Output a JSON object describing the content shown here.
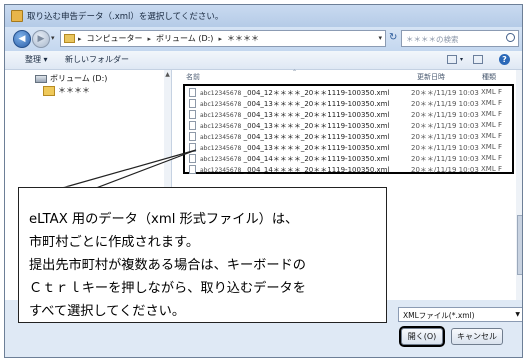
{
  "window": {
    "title": "取り込む申告データ（.xml）を選択してください。"
  },
  "address_bar": {
    "back_glyph": "◀",
    "forward_glyph": "▶",
    "dropdown_glyph": "▾",
    "crumbs": [
      "コンピューター",
      "ボリューム (D:)",
      "＊＊＊＊"
    ],
    "separator": "▸",
    "refresh_glyph": "↻",
    "search_placeholder": "＊＊＊＊の検索"
  },
  "toolbar": {
    "organize_label": "整理 ▾",
    "new_folder_label": "新しいフォルダー",
    "view_icon": "view-options-icon",
    "pane_icon": "preview-pane-icon",
    "help_glyph": "?"
  },
  "nav_pane": {
    "items": [
      {
        "label": "ボリューム (D:)",
        "icon": "drive-icon"
      },
      {
        "label": "＊＊＊＊",
        "icon": "folder-icon"
      }
    ]
  },
  "file_list": {
    "columns": [
      "名前",
      "更新日時",
      "種類"
    ],
    "files": [
      {
        "prefix": "abc12345678",
        "name": "_004_12＊＊＊＊_20＊＊1119-100350.xml",
        "date": "20＊＊/11/19 10:03",
        "type": "XML F"
      },
      {
        "prefix": "abc12345678",
        "name": "_004_13＊＊＊＊_20＊＊1119-100350.xml",
        "date": "20＊＊/11/19 10:03",
        "type": "XML F"
      },
      {
        "prefix": "abc12345678",
        "name": "_004_13＊＊＊＊_20＊＊1119-100350.xml",
        "date": "20＊＊/11/19 10:03",
        "type": "XML F"
      },
      {
        "prefix": "abc12345678",
        "name": "_004_13＊＊＊＊_20＊＊1119-100350.xml",
        "date": "20＊＊/11/19 10:03",
        "type": "XML F"
      },
      {
        "prefix": "abc12345678",
        "name": "_004_13＊＊＊＊_20＊＊1119-100350.xml",
        "date": "20＊＊/11/19 10:03",
        "type": "XML F"
      },
      {
        "prefix": "abc12345678",
        "name": "_004_13＊＊＊＊_20＊＊1119-100350.xml",
        "date": "20＊＊/11/19 10:03",
        "type": "XML F"
      },
      {
        "prefix": "abc12345678",
        "name": "_004_14＊＊＊＊_20＊＊1119-100350.xml",
        "date": "20＊＊/11/19 10:03",
        "type": "XML F"
      },
      {
        "prefix": "abc12345678",
        "name": "_004_14＊＊＊＊_20＊＊1119-100350.xml",
        "date": "20＊＊/11/19 10:03",
        "type": "XML F"
      }
    ]
  },
  "bottom": {
    "filetype_value": "XMLファイル(*.xml)",
    "open_label": "開く(O)",
    "cancel_label": "キャンセル"
  },
  "callout": {
    "lines": [
      "eLTAX 用のデータ（xml 形式ファイル）は、",
      "市町村ごとに作成されます。",
      "提出先市町村が複数ある場合は、キーボードの",
      "Ｃｔｒｌキーを押しながら、取り込むデータを",
      "すべて選択してください。"
    ]
  }
}
